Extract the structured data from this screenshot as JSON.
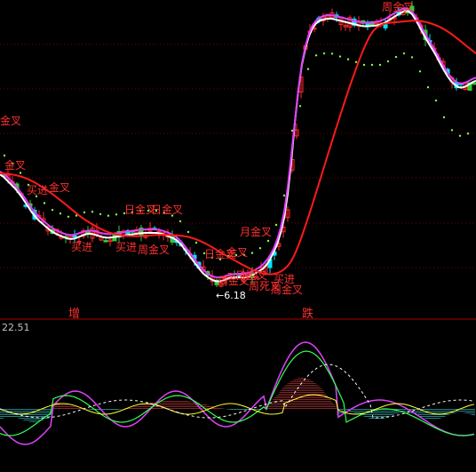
{
  "chart_data": [
    {
      "type": "candlestick",
      "panel": "price",
      "grid": "dotted horizontal lines",
      "colors": {
        "up": "#ff2a2a",
        "down": "#00e5ff",
        "down_alt": "#33cc33",
        "ma_fast": "#ffffff",
        "ma_mid": "#e040fb",
        "ma_slow": "#ff1a1a",
        "sar": "#88ff44",
        "text_signal": "#ff3030"
      },
      "low_marker": {
        "value": "6.18",
        "arrow": "←"
      },
      "signal_labels": [
        "金叉",
        "买进",
        "金叉",
        "买进",
        "周金叉",
        "日金叉",
        "日金叉",
        "月金叉",
        "日金叉",
        "金叉",
        "周金叉",
        "周死叉",
        "买进",
        "周金叉",
        "日金叉",
        "金叉",
        "买进",
        "周金叉"
      ],
      "bottom_tags": [
        "增",
        "跌"
      ]
    },
    {
      "type": "line",
      "panel": "indicator",
      "top_value": "22.51",
      "colors": {
        "line_a": "#e040fb",
        "line_b": "#33ff55",
        "line_c": "#ffffff",
        "line_d": "#ffff33",
        "hist_pos": "#ff5050",
        "hist_neg": "#55ffff"
      }
    }
  ]
}
